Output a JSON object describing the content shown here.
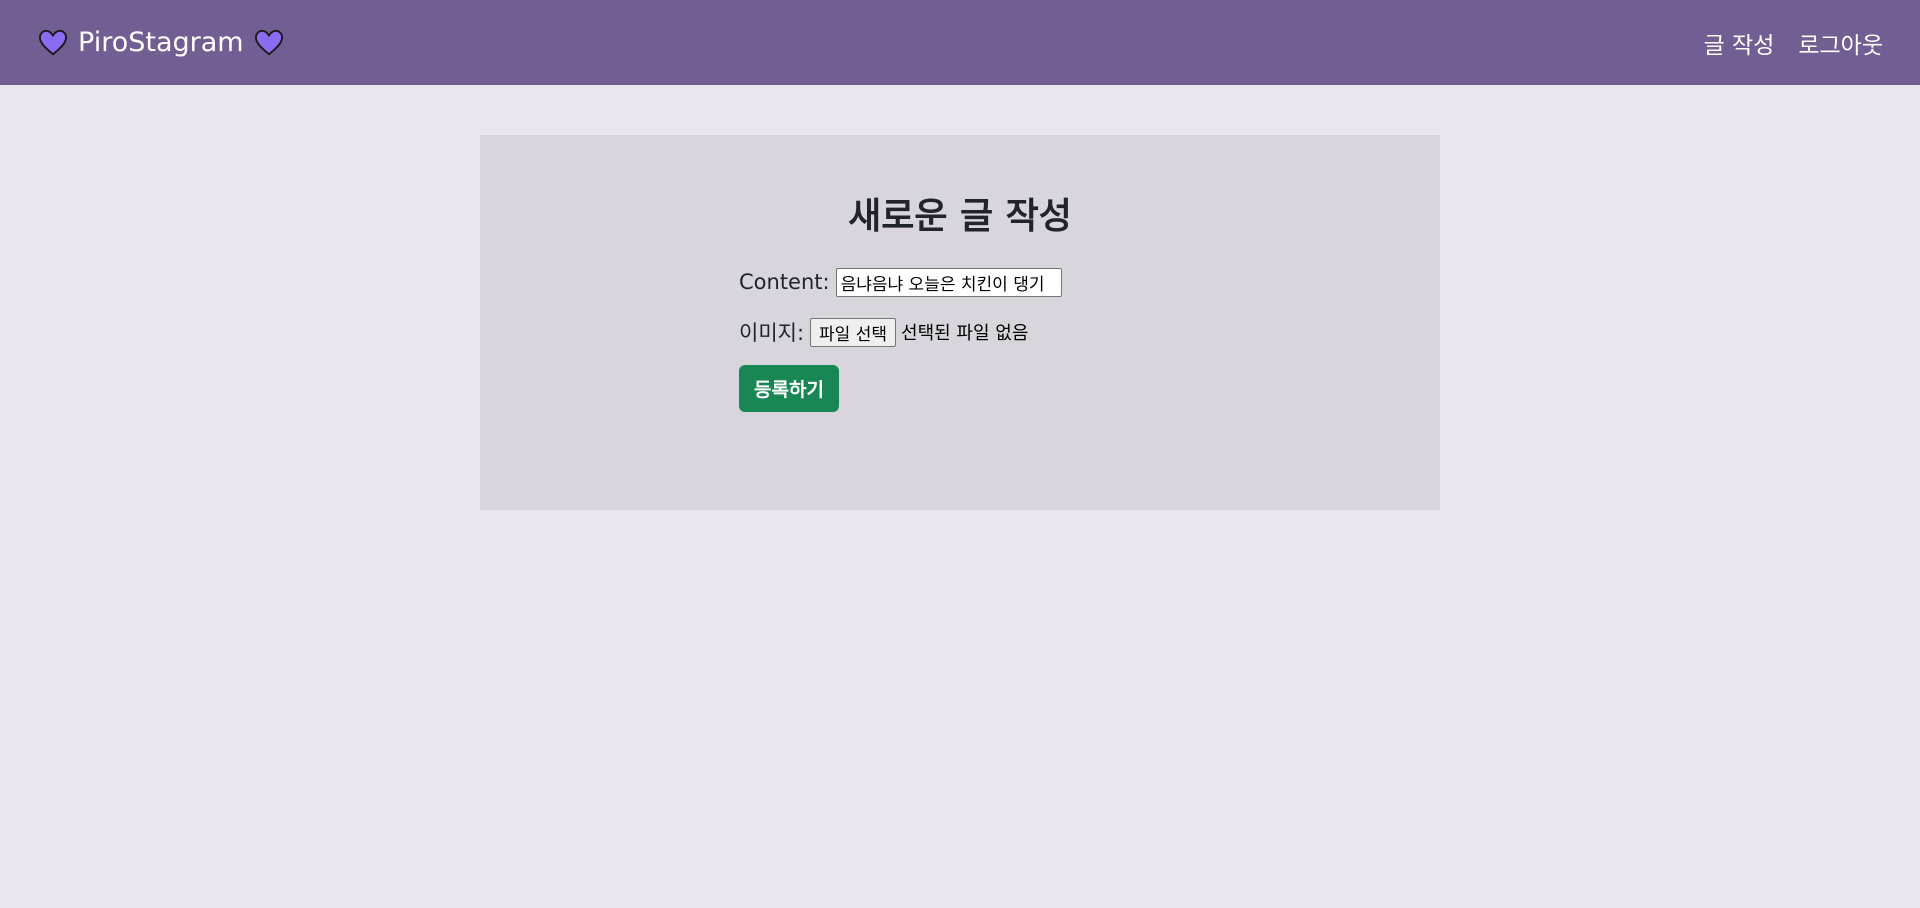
{
  "navbar": {
    "brand": "PiroStagram",
    "brand_icon_left": "heart-icon",
    "brand_icon_right": "heart-icon",
    "links": [
      "글 작성",
      "로그아웃"
    ],
    "colors": {
      "background": "#715e92",
      "heart": "#8b6cf0",
      "text": "#ffffff"
    }
  },
  "page": {
    "background": "#e9e6ef",
    "card_background": "#d8d5dc"
  },
  "form": {
    "title": "새로운 글 작성",
    "content_label": "Content:",
    "content_value": "음냐음냐 오늘은 치킨이 댕기",
    "image_label": "이미지:",
    "file_button_label": "파일 선택",
    "file_status": "선택된 파일 없음",
    "submit_label": "등록하기",
    "submit_color": "#198754"
  }
}
